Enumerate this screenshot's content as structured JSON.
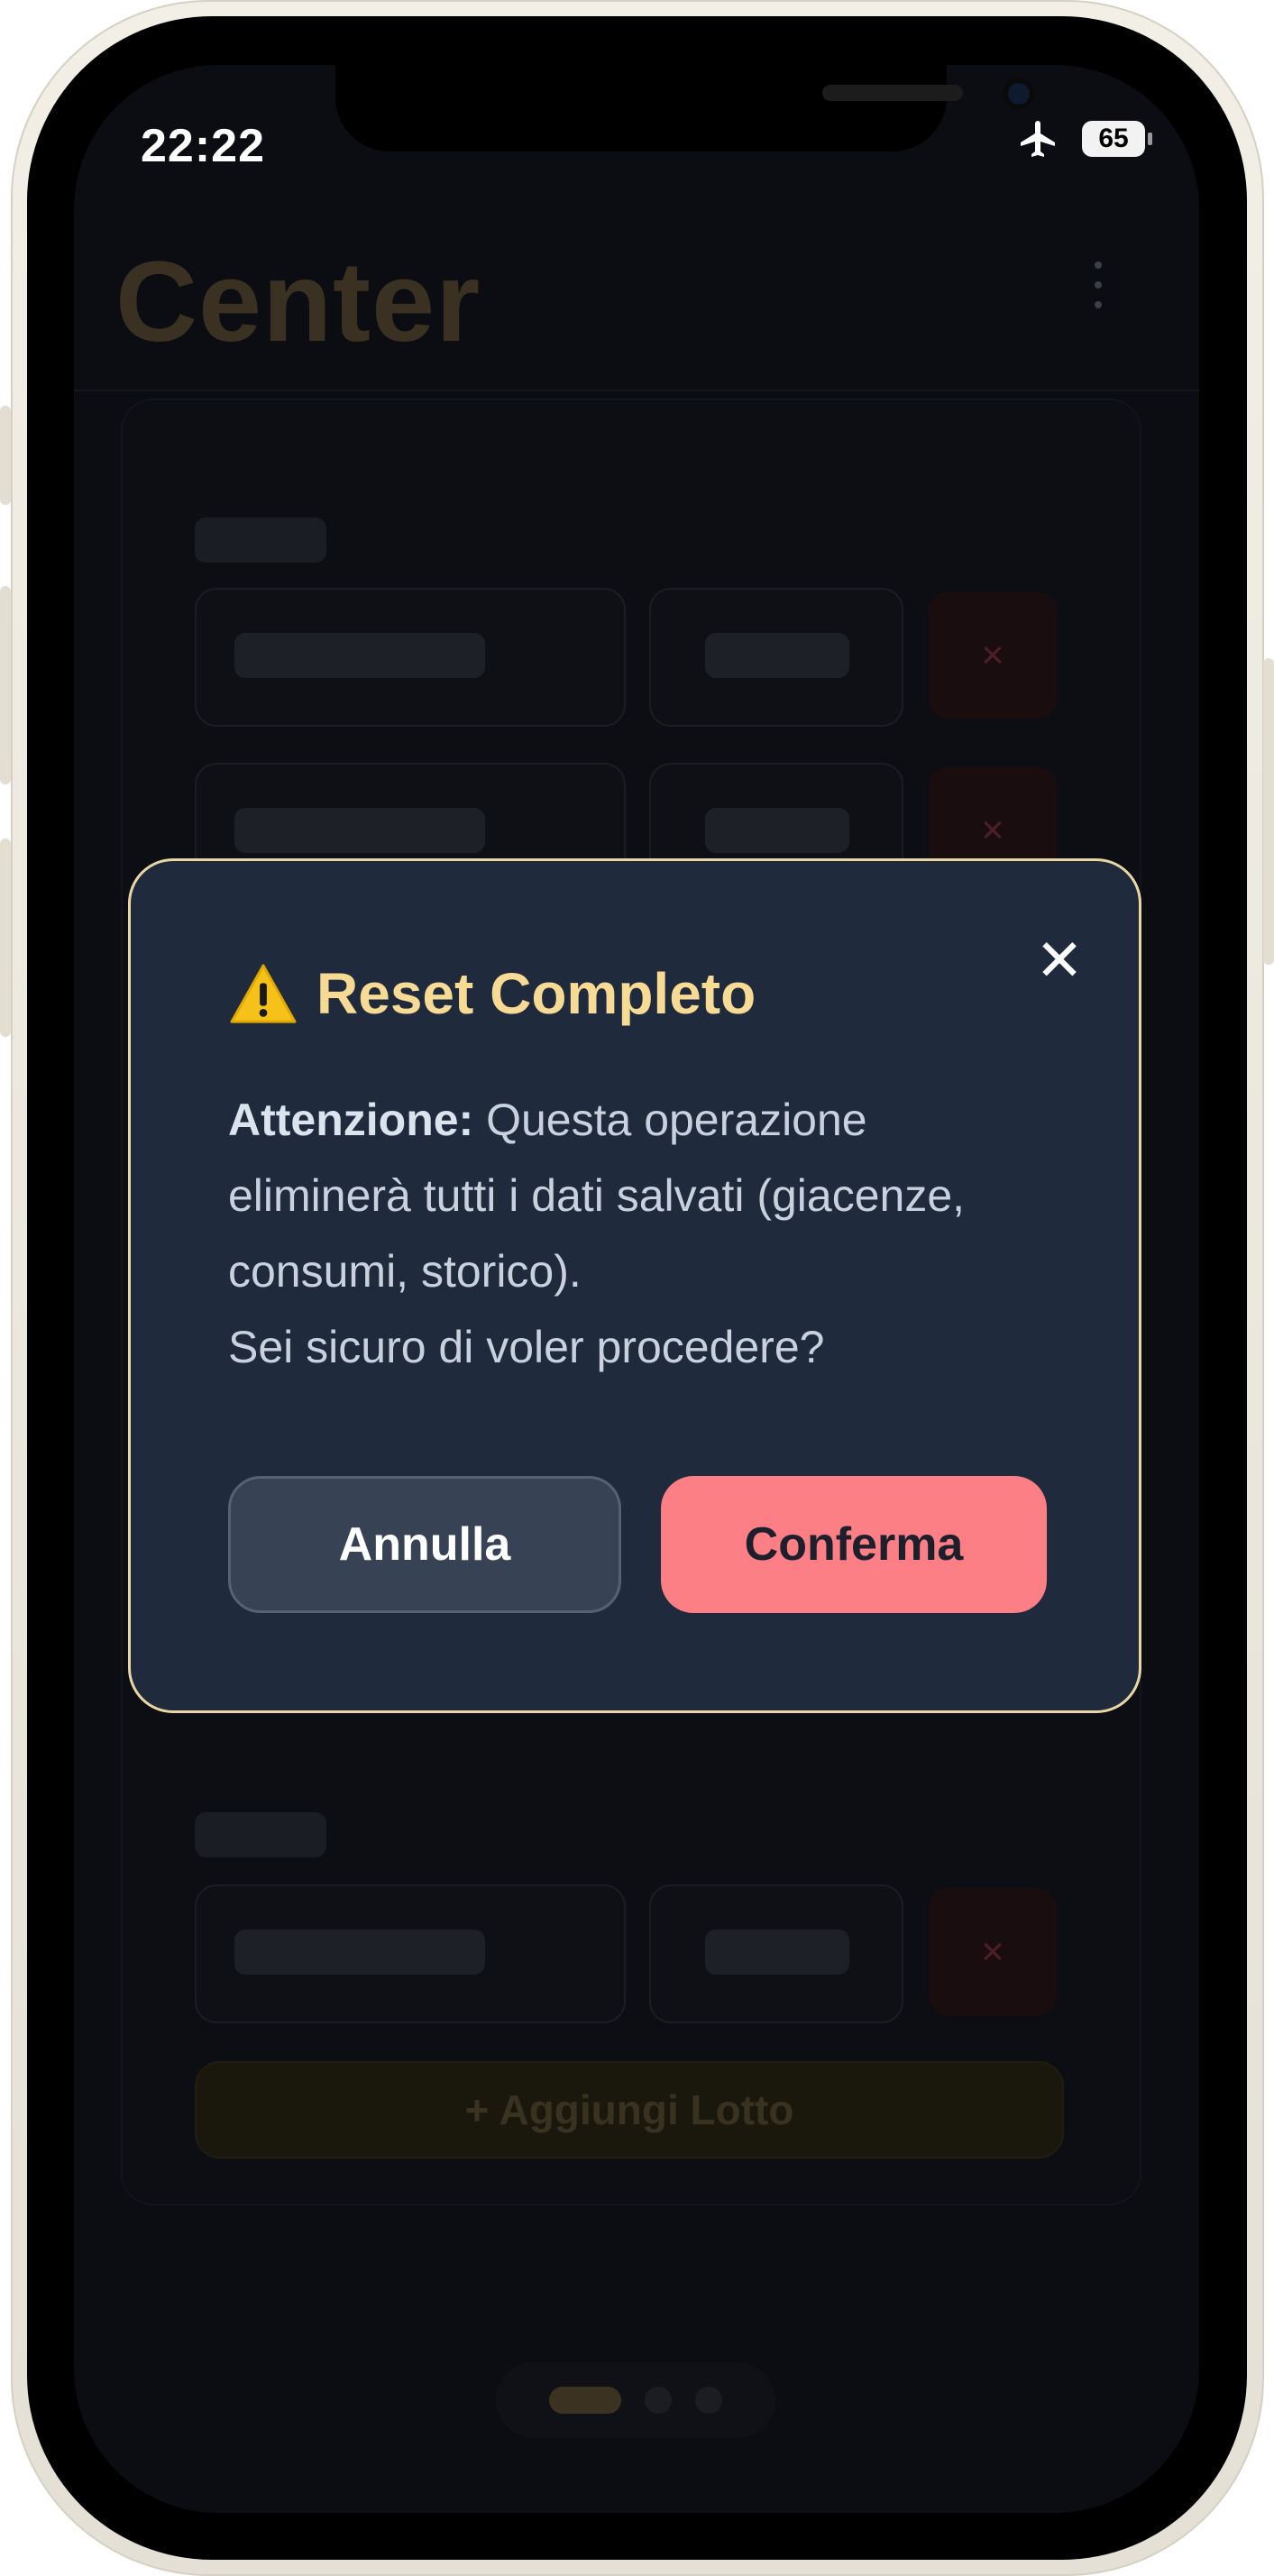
{
  "status_bar": {
    "time": "22:22",
    "battery": "65",
    "airplane_icon": "airplane-icon"
  },
  "app": {
    "title": "Center",
    "menu_icon": "more-vertical-icon",
    "delete_icon_glyph": "×",
    "add_button_label": "+ Aggiungi Lotto"
  },
  "modal": {
    "title": "Reset Completo",
    "title_icon": "warning-icon",
    "close_glyph": "✕",
    "body_bold": "Attenzione:",
    "body_text": " Questa operazione eliminerà tutti i dati salvati (giacenze, consumi, storico).",
    "question": "Sei sicuro di voler procedere?",
    "cancel_label": "Annulla",
    "confirm_label": "Conferma",
    "colors": {
      "accent": "#f7da93",
      "confirm": "#fb7f84",
      "background": "#1f2a3c"
    }
  }
}
